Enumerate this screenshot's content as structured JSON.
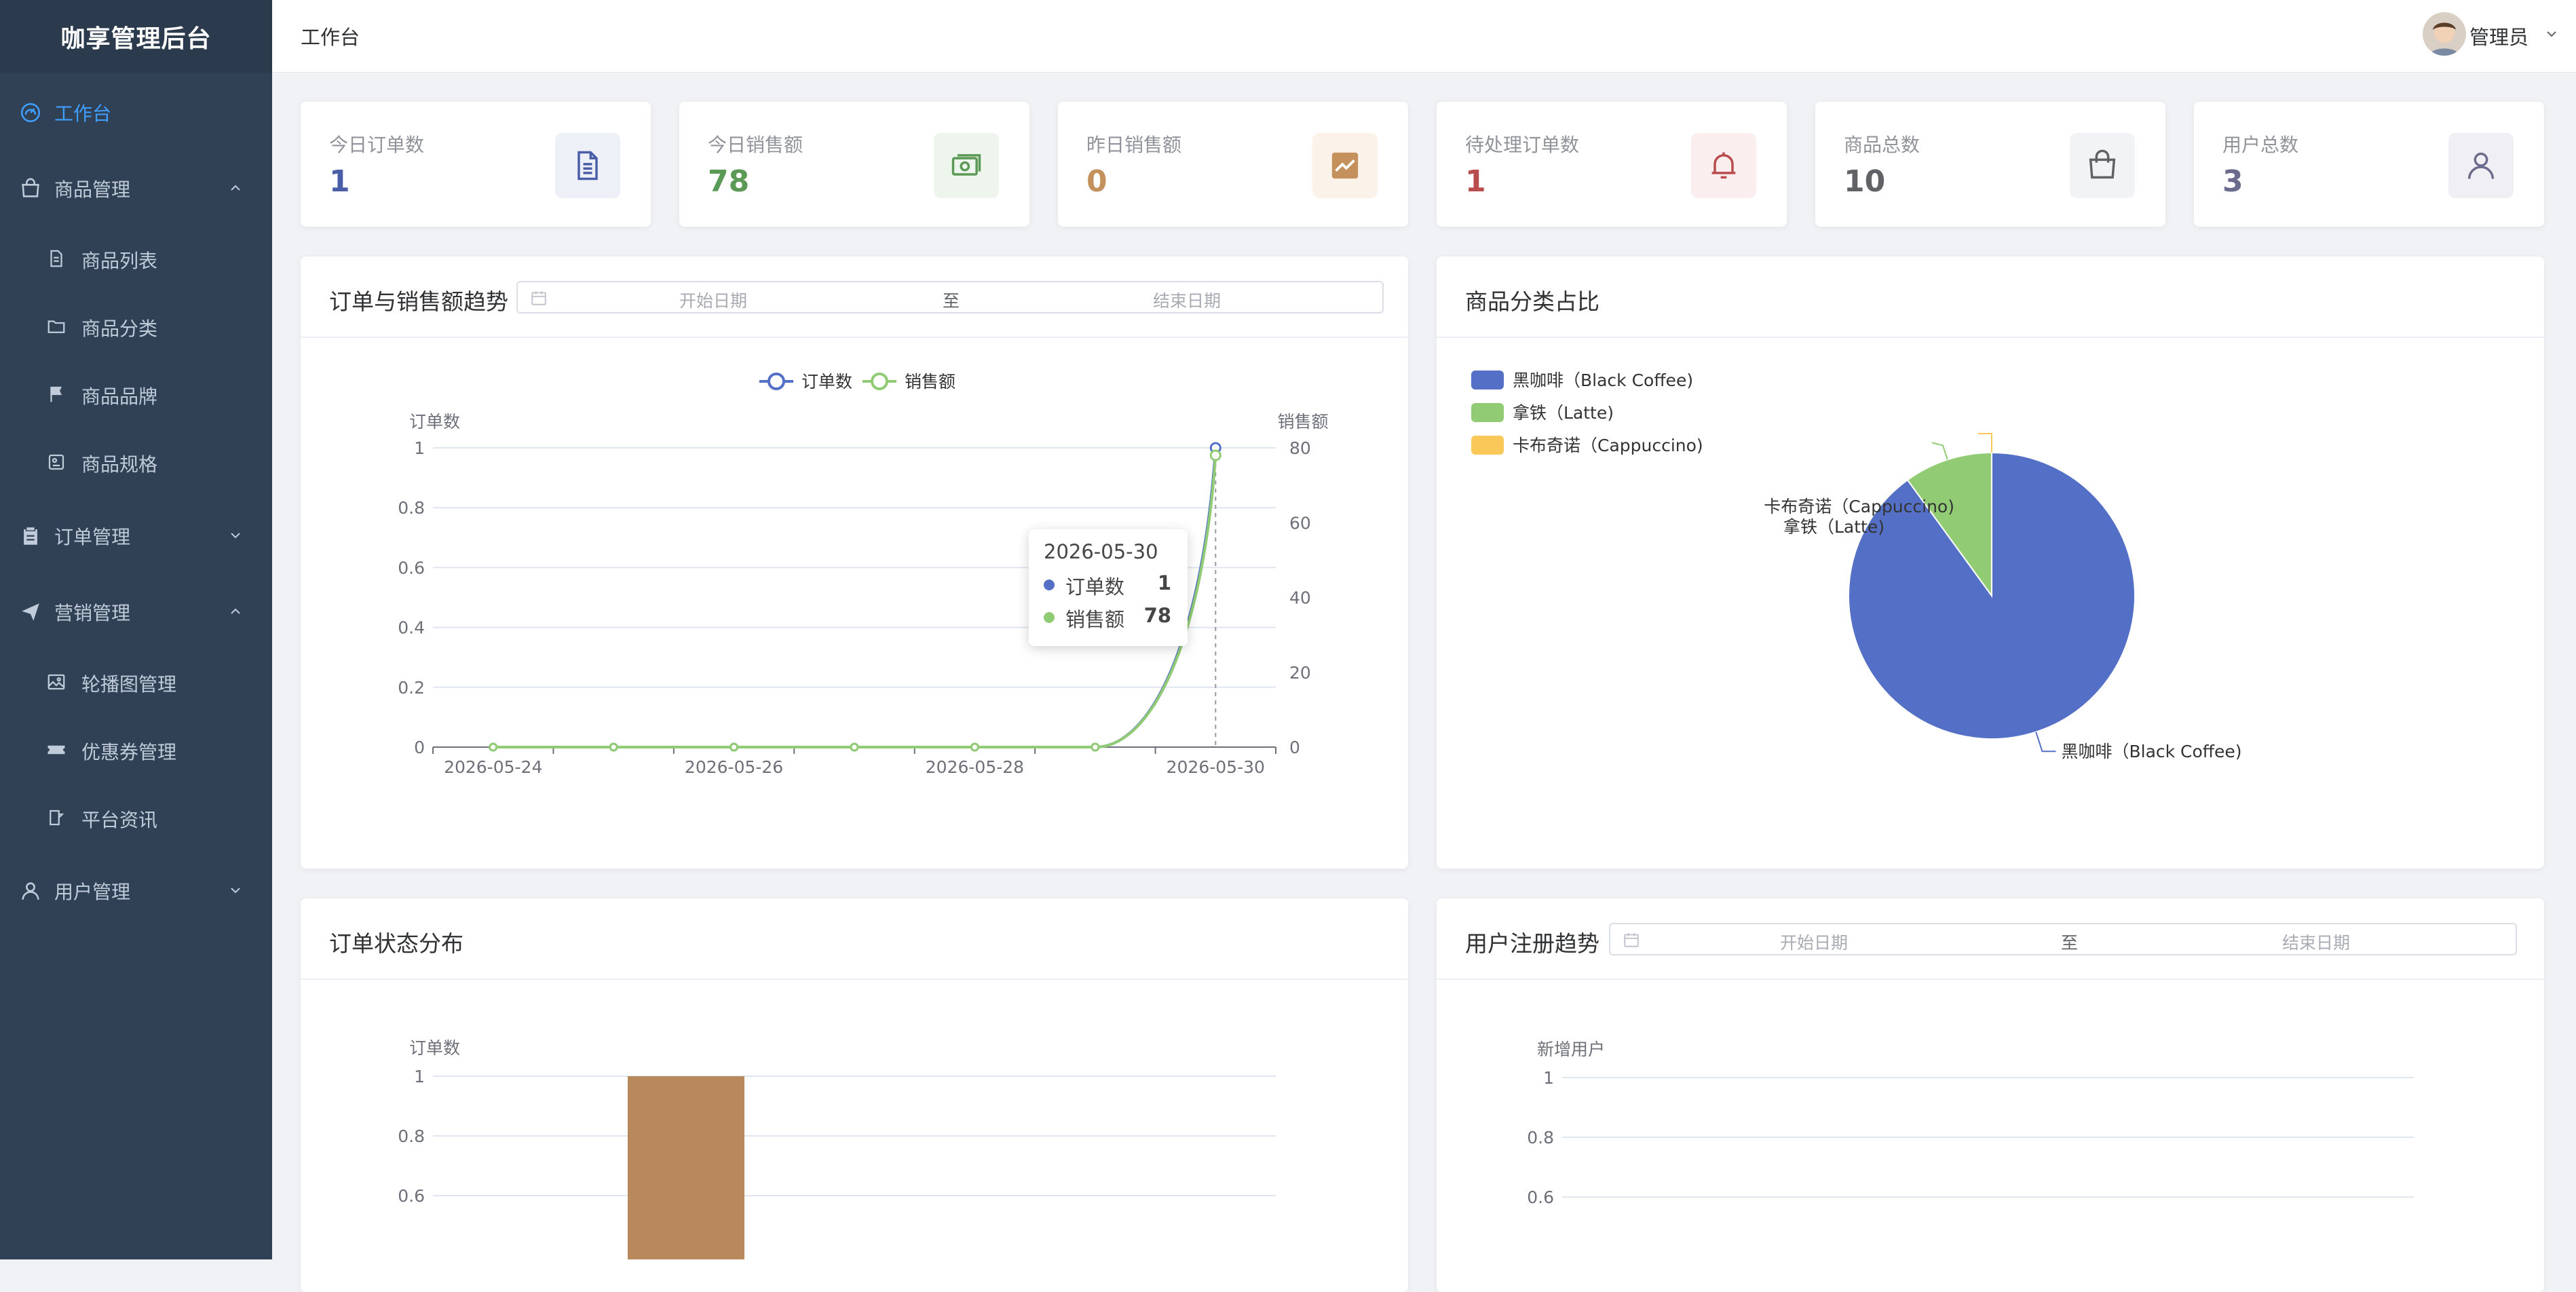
{
  "app": {
    "title": "咖享管理后台"
  },
  "sidebar": {
    "items": [
      {
        "label": "工作台",
        "icon": "dashboard-icon",
        "active": true
      },
      {
        "label": "商品管理",
        "icon": "bag-icon",
        "expanded": true,
        "children": [
          {
            "label": "商品列表",
            "icon": "document-icon"
          },
          {
            "label": "商品分类",
            "icon": "folder-icon"
          },
          {
            "label": "商品品牌",
            "icon": "flag-icon"
          },
          {
            "label": "商品规格",
            "icon": "spec-icon"
          }
        ]
      },
      {
        "label": "订单管理",
        "icon": "clipboard-icon",
        "expanded": false
      },
      {
        "label": "营销管理",
        "icon": "send-icon",
        "expanded": true,
        "children": [
          {
            "label": "轮播图管理",
            "icon": "picture-icon"
          },
          {
            "label": "优惠券管理",
            "icon": "ticket-icon"
          },
          {
            "label": "平台资讯",
            "icon": "news-icon"
          }
        ]
      },
      {
        "label": "用户管理",
        "icon": "user-icon",
        "expanded": false
      }
    ]
  },
  "header": {
    "breadcrumb": "工作台",
    "username": "管理员"
  },
  "stats": [
    {
      "title": "今日订单数",
      "value": "1",
      "color": "#4a5ea8",
      "icon": "document-icon",
      "icon_bg": "#eef0f8"
    },
    {
      "title": "今日销售额",
      "value": "78",
      "color": "#5b9a56",
      "icon": "money-icon",
      "icon_bg": "#eef5ec"
    },
    {
      "title": "昨日销售额",
      "value": "0",
      "color": "#c4915c",
      "icon": "trend-icon",
      "icon_bg": "#fbf3ea"
    },
    {
      "title": "待处理订单数",
      "value": "1",
      "color": "#b94c4c",
      "icon": "bell-icon",
      "icon_bg": "#fbeeee"
    },
    {
      "title": "商品总数",
      "value": "10",
      "color": "#606266",
      "icon": "bag-icon",
      "icon_bg": "#f2f3f5"
    },
    {
      "title": "用户总数",
      "value": "3",
      "color": "#6b6b8e",
      "icon": "user-icon",
      "icon_bg": "#f0f0f4"
    }
  ],
  "trend_panel": {
    "title": "订单与销售额趋势",
    "date_start_placeholder": "开始日期",
    "date_separator": "至",
    "date_end_placeholder": "结束日期",
    "tooltip": {
      "date": "2026-05-30",
      "rows": [
        {
          "name": "订单数",
          "value": "1"
        },
        {
          "name": "销售额",
          "value": "78"
        }
      ]
    }
  },
  "category_panel": {
    "title": "商品分类占比"
  },
  "status_panel": {
    "title": "订单状态分布"
  },
  "register_panel": {
    "title": "用户注册趋势",
    "date_start_placeholder": "开始日期",
    "date_separator": "至",
    "date_end_placeholder": "结束日期"
  },
  "chart_data": [
    {
      "type": "line",
      "x": [
        "2026-05-24",
        "2026-05-25",
        "2026-05-26",
        "2026-05-27",
        "2026-05-28",
        "2026-05-29",
        "2026-05-30"
      ],
      "xticks": [
        "2026-05-24",
        "2026-05-26",
        "2026-05-28",
        "2026-05-30"
      ],
      "series": [
        {
          "name": "订单数",
          "axis": "left",
          "color": "#5470c6",
          "values": [
            0,
            0,
            0,
            0,
            0,
            0,
            1
          ]
        },
        {
          "name": "销售额",
          "axis": "right",
          "color": "#91cc75",
          "values": [
            0,
            0,
            0,
            0,
            0,
            0,
            78
          ]
        }
      ],
      "ylabel": "订单数",
      "ylabel_right": "销售额",
      "ylim": [
        0,
        1
      ],
      "yticks": [
        0,
        0.2,
        0.4,
        0.6,
        0.8,
        1
      ],
      "ylim_right": [
        0,
        80
      ],
      "yticks_right": [
        0,
        20,
        40,
        60,
        80
      ],
      "legend": "top-center",
      "grid": true
    },
    {
      "type": "pie",
      "labels": [
        "黑咖啡（Black Coffee)",
        "拿铁（Latte)",
        "卡布奇诺（Cappuccino)"
      ],
      "values": [
        90,
        10,
        0
      ],
      "colors": [
        "#5470c6",
        "#91cc75",
        "#fac858"
      ],
      "legend": "top-left"
    },
    {
      "type": "bar",
      "ylabel": "订单数",
      "categories": [
        ""
      ],
      "values": [
        1
      ],
      "color": "#b8895c",
      "yticks": [
        0.6,
        0.8,
        1
      ],
      "grid": true
    },
    {
      "type": "line",
      "ylabel": "新增用户",
      "yticks": [
        0.6,
        0.8,
        1
      ],
      "grid": true
    }
  ]
}
